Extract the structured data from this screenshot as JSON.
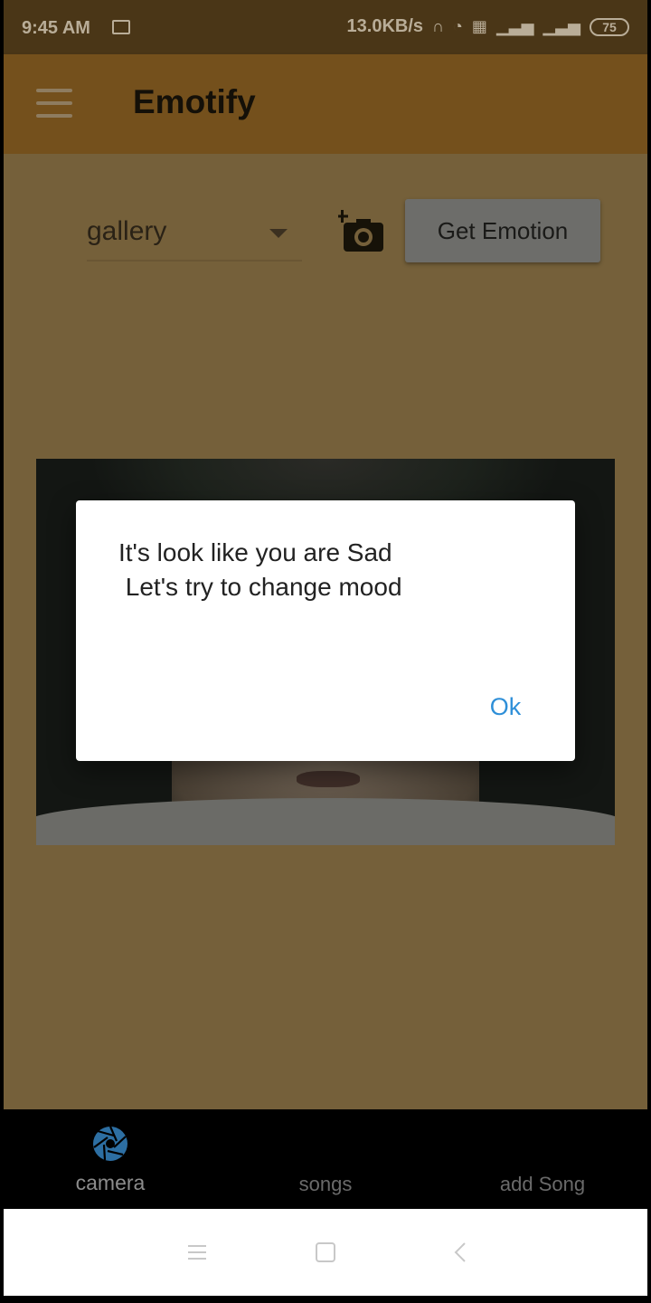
{
  "status_bar": {
    "time": "9:45 AM",
    "network_speed": "13.0KB/s",
    "battery": "75",
    "icons": [
      "video-record-icon",
      "headphones-icon",
      "alarm-icon",
      "data-icon",
      "signal-icon",
      "signal-icon-2",
      "battery-icon"
    ]
  },
  "app_bar": {
    "title": "Emotify",
    "menu_icon": "hamburger-menu-icon"
  },
  "controls": {
    "source_select_value": "gallery",
    "camera_icon": "add-a-photo-icon",
    "get_emotion_label": "Get Emotion"
  },
  "dialog": {
    "line1": "It's look like you are Sad",
    "line2": " Let's try to change mood",
    "ok_label": "Ok"
  },
  "bottom_nav": {
    "items": [
      {
        "label": "camera",
        "icon": "camera-shutter-icon",
        "active": true
      },
      {
        "label": "songs",
        "active": false
      },
      {
        "label": "add Song",
        "active": false
      }
    ],
    "active_color": "#2d6fa3"
  },
  "system_nav": {
    "icons": [
      "recents-icon",
      "home-icon",
      "back-icon"
    ]
  },
  "colors": {
    "app_bar": "#74501c",
    "content_bg": "#75603a",
    "dialog_ok": "#2e8fd8"
  }
}
